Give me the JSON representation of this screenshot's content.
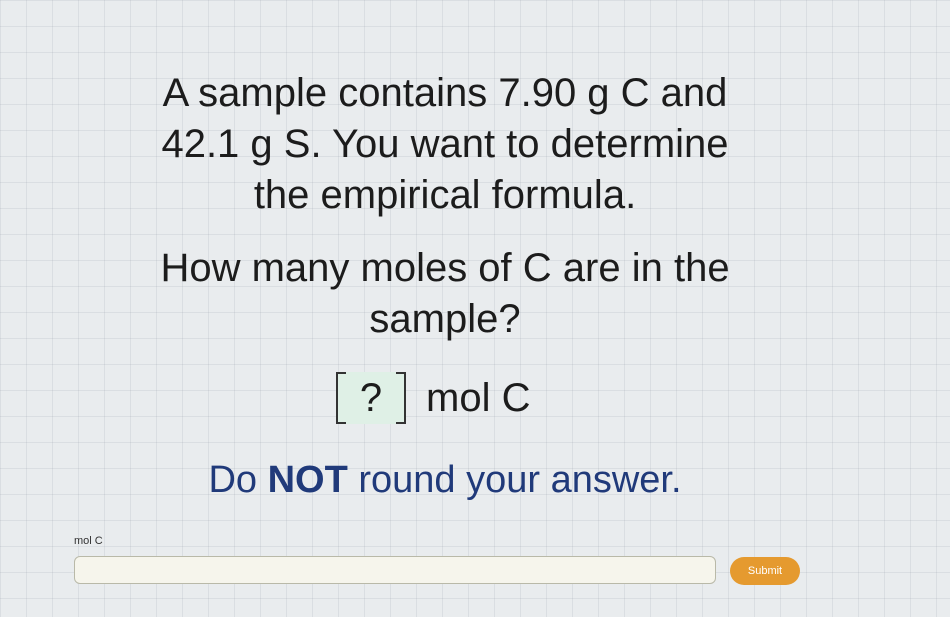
{
  "problem": {
    "lines": [
      "A sample contains 7.90 g C and",
      "42.1 g S. You want to determine",
      "the empirical formula."
    ]
  },
  "question": {
    "lines": [
      "How many moles of C are in the",
      "sample?"
    ]
  },
  "answer_template": {
    "placeholder": "?",
    "unit": "mol C"
  },
  "instruction": {
    "prefix": "Do ",
    "emphasis": "NOT",
    "suffix": " round your answer."
  },
  "answer_form": {
    "unit_label": "mol C",
    "input_value": "",
    "submit_label": "Submit"
  },
  "colors": {
    "accent": "#e59a2f",
    "instruction_text": "#203a7a",
    "placeholder_fill": "#dff0e6"
  }
}
